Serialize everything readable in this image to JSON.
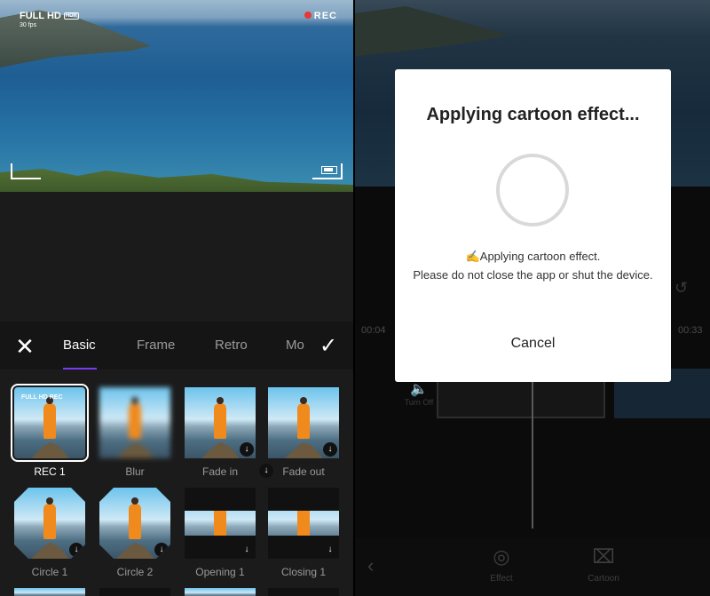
{
  "preview": {
    "quality": "FULL HD",
    "badge": "HDR",
    "fps": "30 fps",
    "rec": "REC"
  },
  "tabs": {
    "items": [
      "Basic",
      "Frame",
      "Retro",
      "Mo"
    ],
    "active_index": 0
  },
  "effects": [
    {
      "label": "REC 1",
      "selected": true,
      "overlay": "FULL HD  REC"
    },
    {
      "label": "Blur"
    },
    {
      "label": "Fade in"
    },
    {
      "label": "Fade out"
    },
    {
      "label": "Circle 1"
    },
    {
      "label": "Circle 2"
    },
    {
      "label": "Opening 1"
    },
    {
      "label": "Closing 1"
    }
  ],
  "editor": {
    "time_start": "00:04",
    "time_end": "00:33",
    "audio_toggle": "Turn Off",
    "tools": [
      {
        "label": "Effect",
        "icon": "effect-icon"
      },
      {
        "label": "Cartoon",
        "icon": "cartoon-icon"
      }
    ]
  },
  "dialog": {
    "title": "Applying cartoon effect...",
    "message_line1": "✍Applying cartoon effect.",
    "message_line2": "Please do not close the app or shut the device.",
    "cancel": "Cancel"
  },
  "colors": {
    "accent": "#7c3aed",
    "rec_dot": "#e53935"
  }
}
